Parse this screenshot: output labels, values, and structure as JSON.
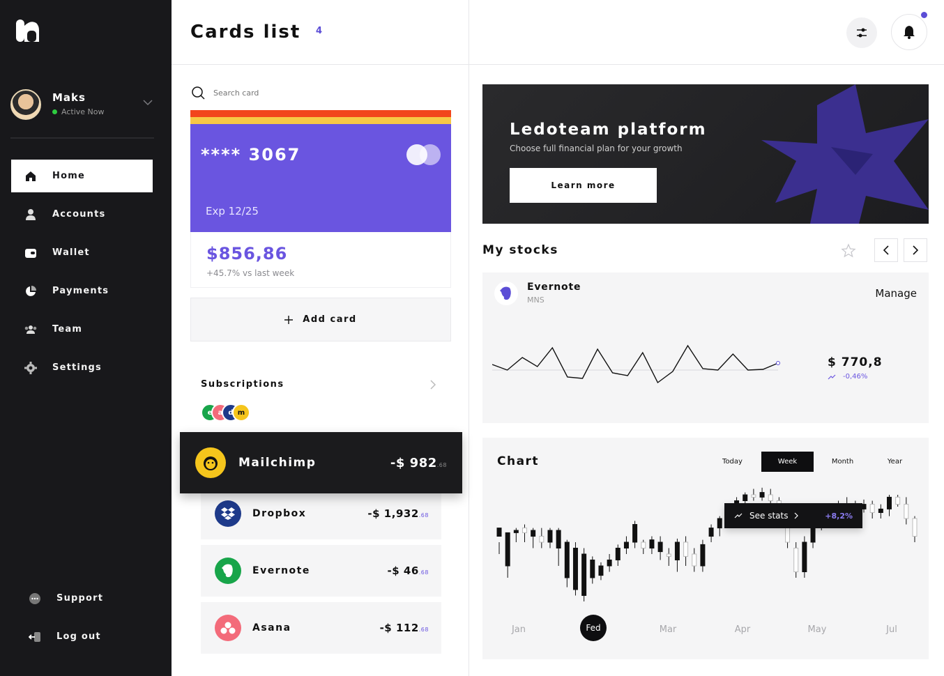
{
  "sidebar": {
    "user": {
      "name": "Maks",
      "status": "Active Now"
    },
    "nav": [
      {
        "label": "Home",
        "icon": "home-icon"
      },
      {
        "label": "Accounts",
        "icon": "user-icon"
      },
      {
        "label": "Wallet",
        "icon": "wallet-icon"
      },
      {
        "label": "Payments",
        "icon": "pie-chart-icon"
      },
      {
        "label": "Team",
        "icon": "team-icon"
      },
      {
        "label": "Settings",
        "icon": "gear-icon"
      }
    ],
    "bottom": [
      {
        "label": "Support",
        "icon": "chat-icon"
      },
      {
        "label": "Log out",
        "icon": "logout-icon"
      }
    ]
  },
  "header": {
    "title": "Cards list",
    "count": "4"
  },
  "cards": {
    "search_placeholder": "Search card",
    "number": "**** 3067",
    "exp": "Exp 12/25",
    "balance": "$856,86",
    "change": "+45.7% vs last week",
    "add_label": "Add card"
  },
  "subscriptions": {
    "title": "Subscriptions",
    "items": [
      {
        "name": "Mailchimp",
        "price": "-$ 982",
        "cents": ".68",
        "color": "#f5c51c",
        "icon": "mailchimp-icon"
      },
      {
        "name": "Dropbox",
        "price": "-$ 1,932",
        "cents": ".68",
        "color": "#1e3a8a",
        "icon": "dropbox-icon"
      },
      {
        "name": "Evernote",
        "price": "-$ 46",
        "cents": ".68",
        "color": "#18a54a",
        "icon": "evernote-icon"
      },
      {
        "name": "Asana",
        "price": "-$ 112",
        "cents": ".68",
        "color": "#f36b7a",
        "icon": "asana-icon"
      }
    ]
  },
  "banner": {
    "title": "Ledoteam platform",
    "subtitle": "Choose full financial plan for your growth",
    "button": "Learn more",
    "accent": "#3b2f8f"
  },
  "stocks": {
    "title": "My stocks",
    "company": "Evernote",
    "ticker": "MNS",
    "manage": "Manage",
    "price": "$ 770,8",
    "change": "-0,46%",
    "series": [
      38,
      30,
      48,
      35,
      62,
      20,
      18,
      60,
      26,
      22,
      55,
      12,
      28,
      65,
      32,
      30,
      53,
      30,
      31,
      40
    ]
  },
  "chart": {
    "title": "Chart",
    "tabs": [
      "Today",
      "Week",
      "Month",
      "Year"
    ],
    "active_tab": "Week",
    "tooltip": {
      "label": "See stats",
      "value": "+8,2%"
    },
    "months": [
      "Jan",
      "Fed",
      "Mar",
      "Apr",
      "May",
      "Jul"
    ],
    "active_month": "Fed",
    "accent": "#5b4dd6"
  },
  "chart_data": {
    "type": "candlestick",
    "categories": [
      "Jan",
      "Fed",
      "Mar",
      "Apr",
      "May",
      "Jul"
    ],
    "candles": [
      [
        0.55,
        0.62,
        0.4,
        0.5
      ],
      [
        0.3,
        0.58,
        0.2,
        0.55
      ],
      [
        0.58,
        0.6,
        0.5,
        0.62
      ],
      [
        0.62,
        0.58,
        0.5,
        0.65
      ],
      [
        0.55,
        0.6,
        0.45,
        0.62
      ],
      [
        0.55,
        0.5,
        0.45,
        0.62
      ],
      [
        0.5,
        0.6,
        0.45,
        0.62
      ],
      [
        0.45,
        0.6,
        0.3,
        0.62
      ],
      [
        0.2,
        0.5,
        0.12,
        0.52
      ],
      [
        0.1,
        0.45,
        0.05,
        0.5
      ],
      [
        0.05,
        0.4,
        0.0,
        0.45
      ],
      [
        0.2,
        0.35,
        0.15,
        0.38
      ],
      [
        0.22,
        0.3,
        0.18,
        0.33
      ],
      [
        0.3,
        0.35,
        0.25,
        0.4
      ],
      [
        0.35,
        0.45,
        0.3,
        0.48
      ],
      [
        0.45,
        0.5,
        0.4,
        0.55
      ],
      [
        0.5,
        0.65,
        0.45,
        0.68
      ],
      [
        0.5,
        0.45,
        0.4,
        0.52
      ],
      [
        0.45,
        0.52,
        0.4,
        0.55
      ],
      [
        0.42,
        0.5,
        0.35,
        0.55
      ],
      [
        0.4,
        0.38,
        0.3,
        0.45
      ],
      [
        0.35,
        0.5,
        0.25,
        0.53
      ],
      [
        0.5,
        0.38,
        0.3,
        0.55
      ],
      [
        0.4,
        0.3,
        0.25,
        0.45
      ],
      [
        0.3,
        0.48,
        0.25,
        0.52
      ],
      [
        0.55,
        0.62,
        0.5,
        0.65
      ],
      [
        0.62,
        0.7,
        0.55,
        0.72
      ],
      [
        0.7,
        0.78,
        0.65,
        0.8
      ],
      [
        0.78,
        0.85,
        0.72,
        0.88
      ],
      [
        0.85,
        0.9,
        0.8,
        0.92
      ],
      [
        0.9,
        0.88,
        0.85,
        0.95
      ],
      [
        0.88,
        0.92,
        0.85,
        0.96
      ],
      [
        0.9,
        0.85,
        0.8,
        0.95
      ],
      [
        0.85,
        0.75,
        0.7,
        0.88
      ],
      [
        0.7,
        0.5,
        0.45,
        0.72
      ],
      [
        0.45,
        0.25,
        0.2,
        0.5
      ],
      [
        0.25,
        0.5,
        0.2,
        0.55
      ],
      [
        0.5,
        0.65,
        0.45,
        0.7
      ],
      [
        0.65,
        0.72,
        0.6,
        0.75
      ],
      [
        0.72,
        0.78,
        0.68,
        0.8
      ],
      [
        0.78,
        0.82,
        0.75,
        0.85
      ],
      [
        0.82,
        0.8,
        0.75,
        0.88
      ],
      [
        0.8,
        0.78,
        0.72,
        0.85
      ],
      [
        0.78,
        0.82,
        0.75,
        0.86
      ],
      [
        0.82,
        0.75,
        0.7,
        0.85
      ],
      [
        0.75,
        0.78,
        0.7,
        0.82
      ],
      [
        0.78,
        0.88,
        0.72,
        0.9
      ],
      [
        0.88,
        0.82,
        0.8,
        0.9
      ],
      [
        0.82,
        0.7,
        0.65,
        0.88
      ],
      [
        0.7,
        0.55,
        0.5,
        0.72
      ]
    ],
    "xlabel": "",
    "ylabel": ""
  }
}
